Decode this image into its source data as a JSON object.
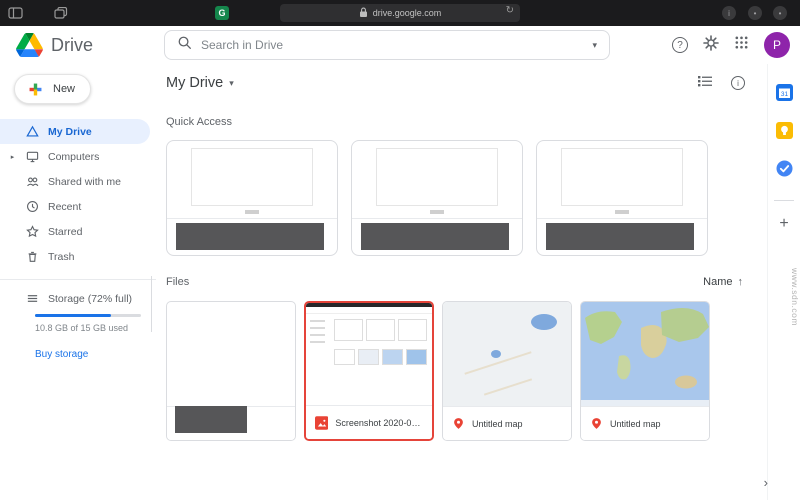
{
  "browser": {
    "url": "drive.google.com"
  },
  "header": {
    "app_name": "Drive",
    "search_placeholder": "Search in Drive",
    "avatar_letter": "P"
  },
  "sidebar": {
    "new_label": "New",
    "items": [
      {
        "label": "My Drive",
        "active": true
      },
      {
        "label": "Computers",
        "active": false
      },
      {
        "label": "Shared with me",
        "active": false
      },
      {
        "label": "Recent",
        "active": false
      },
      {
        "label": "Starred",
        "active": false
      },
      {
        "label": "Trash",
        "active": false
      }
    ],
    "storage": {
      "label": "Storage (72% full)",
      "percent": 72,
      "used": "10.8 GB of 15 GB used",
      "buy_label": "Buy storage"
    }
  },
  "main": {
    "title": "My Drive",
    "quick_access_label": "Quick Access",
    "files_label": "Files",
    "sort_label": "Name",
    "files": [
      {
        "name": "Screenshot 2020-06-...",
        "type": "image",
        "selected": true
      },
      {
        "name": "Untitled map",
        "type": "map",
        "selected": false
      },
      {
        "name": "Untitled map",
        "type": "map",
        "selected": false
      }
    ]
  },
  "icons": {
    "caret_down": "▾",
    "expand_right": "▸",
    "sort_arrow_up": "↑",
    "plus": "+",
    "chevron_right": "›",
    "refresh": "↻",
    "help": "?",
    "info": "i",
    "extension_g": "G"
  },
  "colors": {
    "accent_blue": "#1a73e8",
    "active_text": "#1967d2",
    "active_bg": "#e8f0fe",
    "selection_red": "#e5443a",
    "redaction_gray": "#565658"
  },
  "watermark": "www.sdn.com"
}
